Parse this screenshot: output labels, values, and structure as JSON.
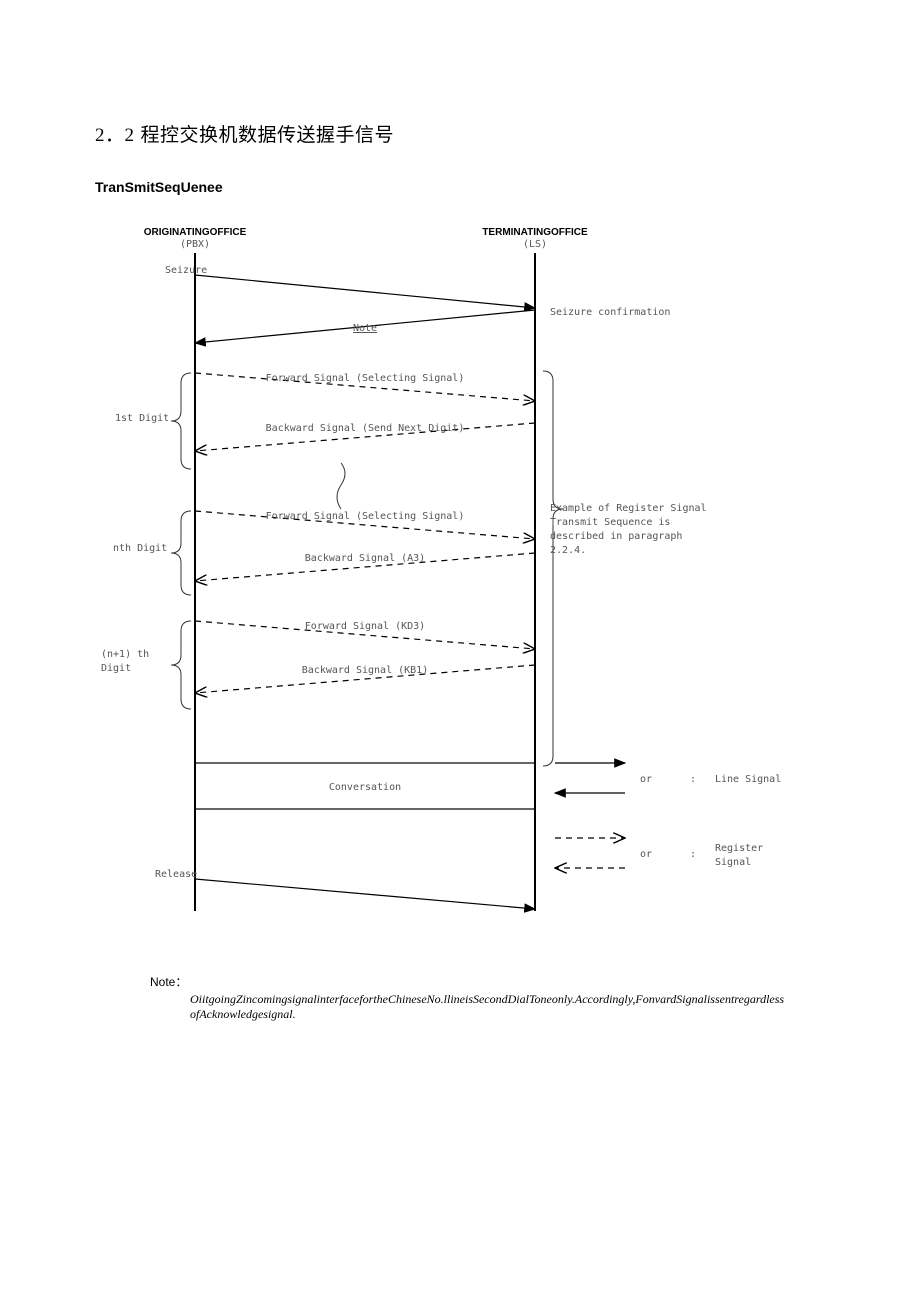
{
  "heading": {
    "number": "2．2",
    "title": "程控交换机数据传送握手信号"
  },
  "subheading": "TranSmitSeqUenee",
  "diagram": {
    "originating": {
      "title": "ORIGINATINGOFFICE",
      "sub": "(PBX)"
    },
    "terminating": {
      "title": "TERMINATINGOFFICE",
      "sub": "(LS)"
    },
    "left_labels": {
      "seizure": "Seizure",
      "first_digit": "1st Digit",
      "nth_digit": "nth Digit",
      "n1_digit_a": "(n+1) th",
      "n1_digit_b": "Digit",
      "release": "Release"
    },
    "signals": {
      "note_word": "Note",
      "seizure_confirm": "Seizure confirmation",
      "fwd_selecting1": "Forward Signal (Selecting Signal)",
      "bwd_send_next": "Backward Signal (Send Next Digit)",
      "fwd_selecting2": "Forward Signal (Selecting Signal)",
      "bwd_a3": "Backward Signal (A3)",
      "fwd_kd3": "Forward Signal (KD3)",
      "bwd_kb1": "Backward Signal (KB1)",
      "conversation": "Conversation",
      "example": {
        "l1": "Example of Register Signal",
        "l2": "Transmit Sequence is",
        "l3": "described in paragraph",
        "l4": "2.2.4."
      }
    },
    "legend": {
      "or1": "or",
      "colon1": ":",
      "line_signal": "Line Signal",
      "or2": "or",
      "colon2": ":",
      "register": "Register",
      "signal": "Signal"
    }
  },
  "note": {
    "label": "Note：",
    "text": "OiitgoingZincomingsignalinterfacefortheChineseNo.llineisSecondDialToneonly.Accordingly,FonvardSignalissentregardlessofAcknowledgesignal."
  }
}
